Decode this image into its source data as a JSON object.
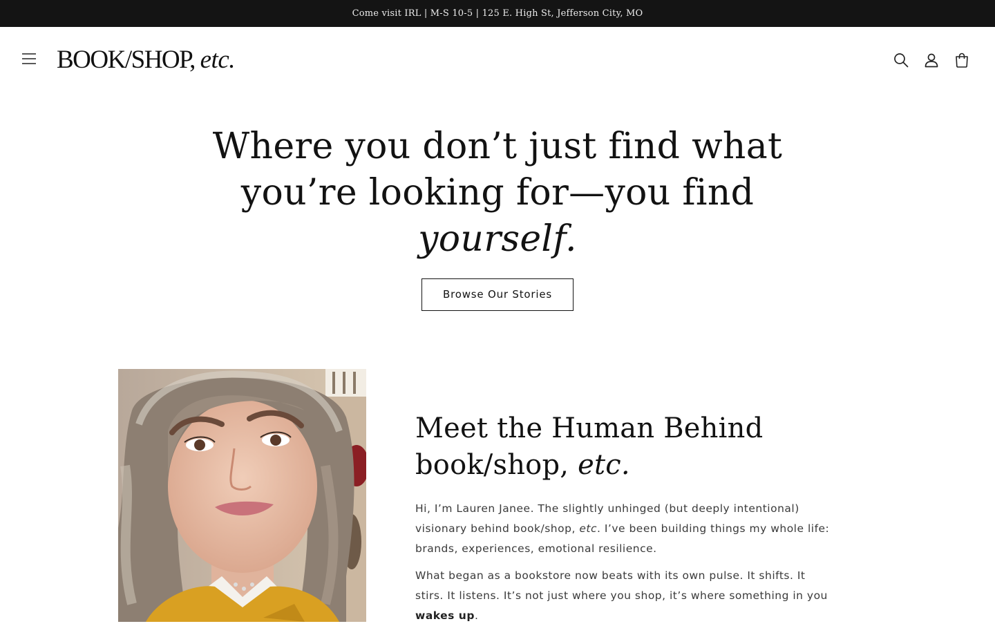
{
  "announcement": {
    "text": "Come visit IRL | M-S 10-5 | 125 E. High St, Jefferson City, MO"
  },
  "header": {
    "logo_main": "BOOK/SHOP,",
    "logo_etc": "etc.",
    "icons": {
      "menu": "hamburger-menu-icon",
      "search": "search-icon",
      "account": "account-login-icon",
      "cart": "shopping-bag-icon"
    }
  },
  "hero": {
    "title_line1": "Where you don’t just find what",
    "title_line2": "you’re looking for—you find",
    "title_em": "yourself.",
    "button_label": "Browse Our Stories"
  },
  "about": {
    "title_line1": "Meet the Human Behind",
    "title_line2": "book/shop,",
    "title_em": "etc.",
    "p1_start": "Hi, I’m Lauren Janee. The slightly unhinged (but deeply intentional) visionary behind book/shop,",
    "p1_em": "etc",
    "p1_end": ". I’ve been building things my whole life: brands, experiences, emotional resilience.",
    "p2_start": "What began as a bookstore now beats with its own pulse. It shifts. It stirs. It listens. It’s not just where you shop, it’s where something in you",
    "p2_strong": "wakes up",
    "p2_end": "."
  },
  "colors": {
    "announcement_bg": "#141414",
    "text_primary": "#121212",
    "body_text": "#3a3a3a",
    "background": "#ffffff"
  }
}
